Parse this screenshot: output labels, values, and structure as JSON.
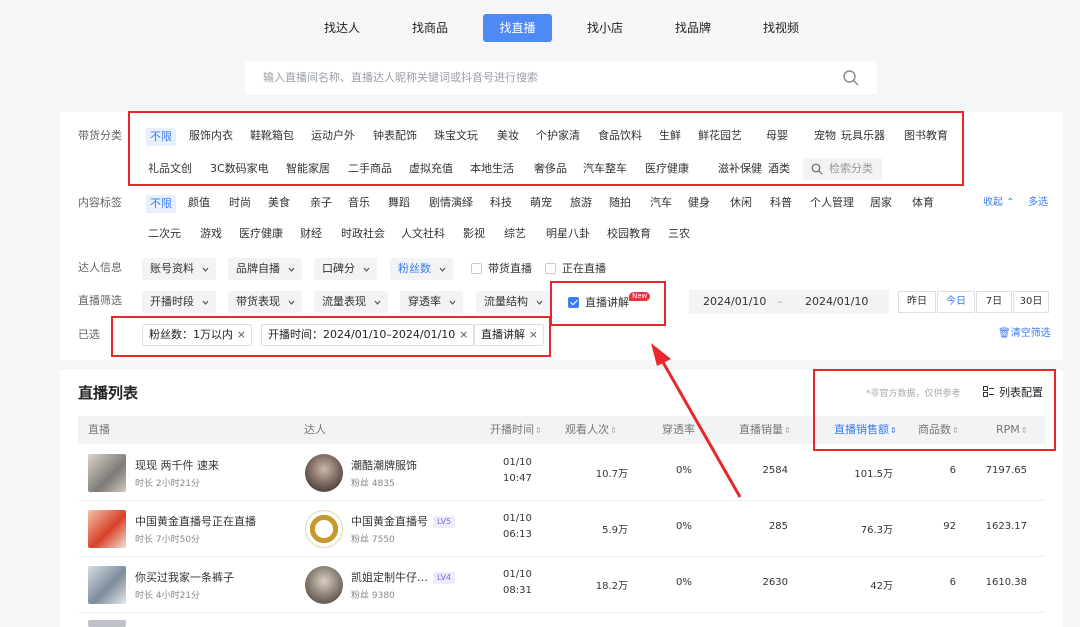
{
  "top_nav": [
    "找达人",
    "找商品",
    "找直播",
    "找小店",
    "找品牌",
    "找视频"
  ],
  "search": {
    "placeholder": "输入直播间名称、直播达人昵称关键词或抖音号进行搜索"
  },
  "filters": {
    "category": {
      "label": "带货分类",
      "row1": [
        "不限",
        "服饰内衣",
        "鞋靴箱包",
        "运动户外",
        "钟表配饰",
        "珠宝文玩",
        "美妆",
        "个护家清",
        "食品饮料",
        "生鲜",
        "鲜花园艺",
        "母婴",
        "宠物",
        "玩具乐器",
        "图书教育"
      ],
      "row2": [
        "礼品文创",
        "3C数码家电",
        "智能家居",
        "二手商品",
        "虚拟充值",
        "本地生活",
        "奢侈品",
        "汽车整车",
        "医疗健康",
        "滋补保健",
        "酒类"
      ],
      "search_placeholder": "检索分类"
    },
    "content": {
      "label": "内容标签",
      "row1": [
        "不限",
        "颜值",
        "时尚",
        "美食",
        "亲子",
        "音乐",
        "舞蹈",
        "剧情演绎",
        "科技",
        "萌宠",
        "旅游",
        "随拍",
        "汽车",
        "健身",
        "休闲",
        "科普",
        "个人管理",
        "居家",
        "体育"
      ],
      "row2": [
        "二次元",
        "游戏",
        "医疗健康",
        "财经",
        "时政社会",
        "人文社科",
        "影视",
        "综艺",
        "明星八卦",
        "校园教育",
        "三农"
      ],
      "collapse": "收起",
      "multi": "多选"
    },
    "creator": {
      "label": "达人信息",
      "dropdowns": [
        "账号资料",
        "品牌自播",
        "口碑分",
        "粉丝数"
      ],
      "checkboxes": [
        "带货直播",
        "正在直播"
      ]
    },
    "live": {
      "label": "直播筛选",
      "dropdowns": [
        "开播时段",
        "带货表现",
        "流量表现",
        "穿透率",
        "流量结构"
      ],
      "explain_checkbox": "直播讲解",
      "new_badge": "New",
      "date_from": "2024/01/10",
      "date_sep": "–",
      "date_to": "2024/01/10",
      "quick": [
        "昨日",
        "今日",
        "7日",
        "30日"
      ]
    },
    "selected": {
      "label": "已选",
      "chips": [
        "粉丝数：1万以内",
        "开播时间：2024/01/10–2024/01/10",
        "直播讲解"
      ],
      "clear": "清空筛选"
    }
  },
  "list": {
    "title": "直播列表",
    "note": "*非官方数据，仅供参考",
    "config": "列表配置",
    "columns": [
      "直播",
      "达人",
      "开播时间",
      "观看人次",
      "穿透率",
      "直播销量",
      "直播销售额",
      "商品数",
      "RPM"
    ],
    "rows": [
      {
        "title": "现现 两千件 速来",
        "duration": "时长 2小时21分",
        "creator": "潮酷潮牌服饰",
        "level": "",
        "fans": "粉丝 4835",
        "date": "01/10",
        "time": "10:47",
        "views": "10.7万",
        "pen": "0%",
        "sales": "2584",
        "gmv": "101.5万",
        "items": "6",
        "rpm": "7197.65"
      },
      {
        "title": "中国黄金直播号正在直播",
        "duration": "时长 7小时50分",
        "creator": "中国黄金直播号",
        "level": "LV5",
        "fans": "粉丝 7550",
        "date": "01/10",
        "time": "06:13",
        "views": "5.9万",
        "pen": "0%",
        "sales": "285",
        "gmv": "76.3万",
        "items": "92",
        "rpm": "1623.17"
      },
      {
        "title": "你买过我家一条裤子",
        "duration": "时长 4小时21分",
        "creator": "凯姐定制牛仔…",
        "level": "LV4",
        "fans": "粉丝 9380",
        "date": "01/10",
        "time": "08:31",
        "views": "18.2万",
        "pen": "0%",
        "sales": "2630",
        "gmv": "42万",
        "items": "6",
        "rpm": "1610.38"
      }
    ]
  },
  "colors": {
    "accent": "#4d8af5",
    "annotation_red": "#e8262b",
    "text_blue": "#3b7cf0"
  }
}
